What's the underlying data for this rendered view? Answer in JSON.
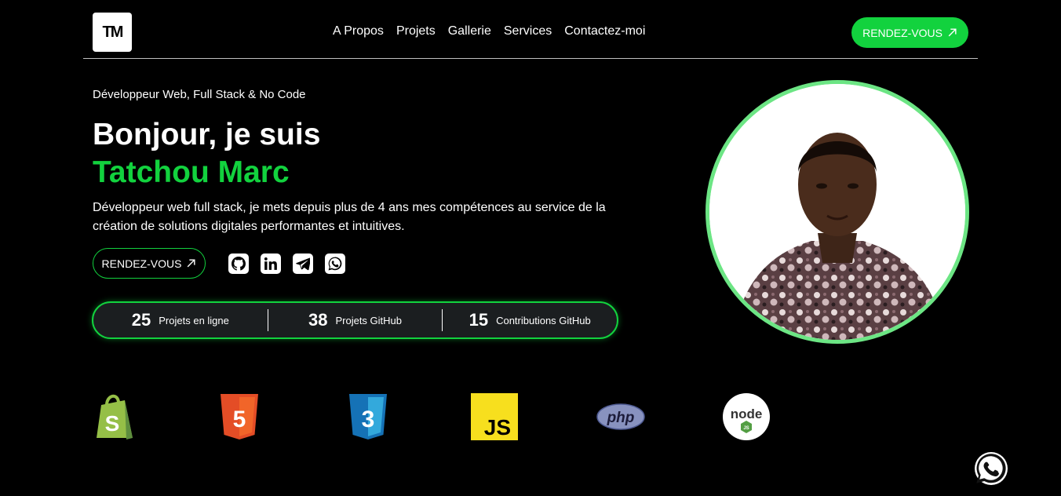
{
  "brand": {
    "logo_text": "TM"
  },
  "nav": {
    "items": [
      "A Propos",
      "Projets",
      "Gallerie",
      "Services",
      "Contactez-moi"
    ]
  },
  "header": {
    "cta_label": "RENDEZ-VOUS"
  },
  "hero": {
    "subtitle": "Développeur Web, Full Stack & No Code",
    "greeting": "Bonjour, je suis",
    "name": "Tatchou Marc",
    "description": "Développeur web full stack, je mets depuis plus de 4 ans mes compétences au service de la création de solutions digitales performantes et intuitives.",
    "cta_label": "RENDEZ-VOUS"
  },
  "socials": [
    "github-icon",
    "linkedin-icon",
    "telegram-icon",
    "whatsapp-icon"
  ],
  "stats": [
    {
      "value": "25",
      "label": "Projets en ligne"
    },
    {
      "value": "38",
      "label": "Projets GitHub"
    },
    {
      "value": "15",
      "label": "Contributions GitHub"
    }
  ],
  "tech": [
    "shopify-icon",
    "html5-icon",
    "css3-icon",
    "javascript-icon",
    "php-icon",
    "nodejs-icon"
  ],
  "tech_text": {
    "js": "JS",
    "php": "php",
    "node": "node",
    "node_badge": "JS"
  },
  "colors": {
    "accent": "#12d23e",
    "ring": "#6ce584",
    "background": "#000000",
    "stats_bg": "#1b1e20"
  }
}
